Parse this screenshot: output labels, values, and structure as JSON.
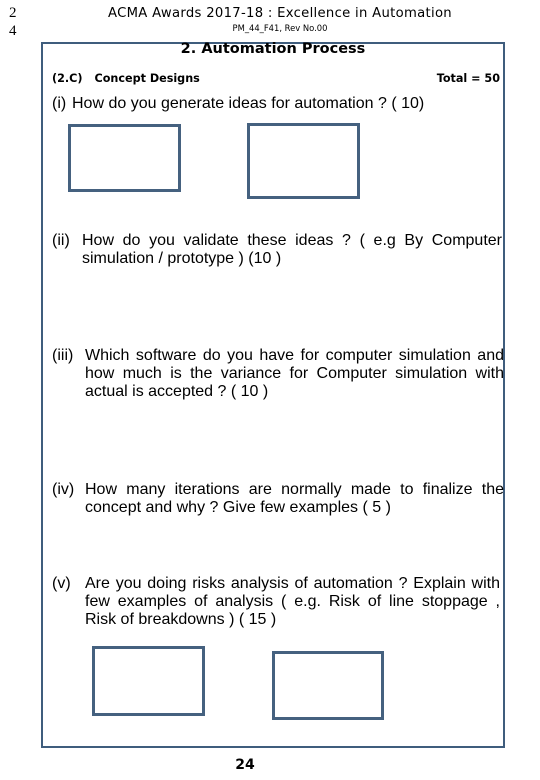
{
  "margin_digits": [
    "2",
    "4"
  ],
  "header": {
    "title": "ACMA  Awards  2017-18 : Excellence in Automation",
    "subtitle": "PM_44_F41, Rev No.00"
  },
  "section": {
    "title": "2. Automation Process"
  },
  "subsection": {
    "code": "(2.C)",
    "name": "Concept Designs",
    "total": "Total  = 50"
  },
  "questions": [
    {
      "label": "(i)",
      "text": "How  do you  generate  ideas  for  automation ? ( 10)"
    },
    {
      "label": "(ii)",
      "text": "How  do  you  validate  these  ideas ?  ( e.g By  Computer  simulation /  prototype ) (10 )"
    },
    {
      "label": "(iii)",
      "text": "Which  software  do  you  have   for computer  simulation  and  how  much  is  the  variance   for Computer  simulation  with  actual is  accepted ? ( 10 )"
    },
    {
      "label": "(iv)",
      "text": "How  many  iterations   are normally  made  to  finalize the  concept  and  why ?  Give  few  examples  ( 5 )"
    },
    {
      "label": "(v)",
      "text": "Are  you  doing risks analysis  of  automation ?  Explain  with  few  examples  of  analysis  ( e.g. Risk  of  line  stoppage ,  Risk of    breakdowns ) ( 15 )"
    }
  ],
  "answer_boxes": [
    {
      "name": "answer-box-1"
    },
    {
      "name": "answer-box-2"
    },
    {
      "name": "answer-box-3"
    },
    {
      "name": "answer-box-4"
    }
  ],
  "page_number": "24",
  "colors": {
    "frame_border": "#3f5d7d",
    "box_border": "#45617f",
    "text": "#000000",
    "background": "#ffffff"
  }
}
